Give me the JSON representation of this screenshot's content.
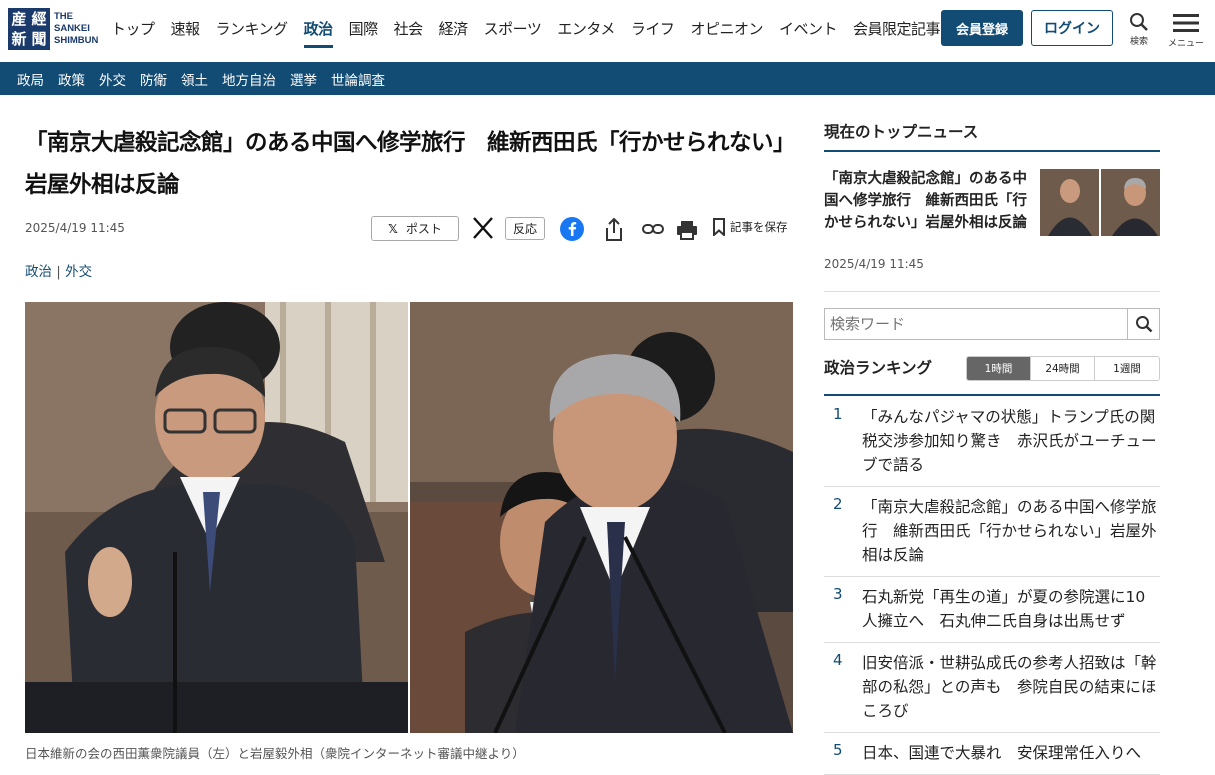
{
  "brand": {
    "logo_chars": [
      "産",
      "經",
      "新",
      "聞"
    ],
    "name_line1": "THE",
    "name_line2": "SANKEI",
    "name_line3": "SHIMBUN",
    "accent": "#124b73"
  },
  "nav": {
    "items": [
      "トップ",
      "速報",
      "ランキング",
      "政治",
      "国際",
      "社会",
      "経済",
      "スポーツ",
      "エンタメ",
      "ライフ",
      "オピニオン",
      "イベント",
      "会員限定記事"
    ],
    "active": "政治",
    "register_label": "会員登録",
    "login_label": "ログイン",
    "search_label": "検索",
    "menu_label": "メニュー"
  },
  "subnav": {
    "items": [
      "政局",
      "政策",
      "外交",
      "防衛",
      "領土",
      "地方自治",
      "選挙",
      "世論調査"
    ]
  },
  "article": {
    "headline": "「南京大虐殺記念館」のある中国へ修学旅行　維新西田氏「行かせられない」岩屋外相は反論",
    "date": "2025/4/19 11:45",
    "share_post": "ポスト",
    "share_react": "反応",
    "save_label": "記事を保存",
    "category_1": "政治",
    "category_sep": "|",
    "category_2": "外交",
    "caption": "日本維新の会の西田薫衆院議員（左）と岩屋毅外相（衆院インターネット審議中継より）"
  },
  "sidebar": {
    "top_news_heading": "現在のトップニュース",
    "top_news_title": "「南京大虐殺記念館」のある中国へ修学旅行　維新西田氏「行かせられない」岩屋外相は反論",
    "top_news_date": "2025/4/19 11:45",
    "search_placeholder": "検索ワード",
    "ranking_heading": "政治ランキング",
    "ranking_tabs": [
      "1時間",
      "24時間",
      "1週間"
    ],
    "ranking_active_tab": "1時間",
    "ranking": [
      {
        "num": "1",
        "title": "「みんなパジャマの状態」トランプ氏の関税交渉参加知り驚き　赤沢氏がユーチューブで語る"
      },
      {
        "num": "2",
        "title": "「南京大虐殺記念館」のある中国へ修学旅行　維新西田氏「行かせられない」岩屋外相は反論"
      },
      {
        "num": "3",
        "title": "石丸新党「再生の道」が夏の参院選に10人擁立へ　石丸伸二氏自身は出馬せず"
      },
      {
        "num": "4",
        "title": "旧安倍派・世耕弘成氏の参考人招致は「幹部の私怨」との声も　参院自民の結束にほころび"
      },
      {
        "num": "5",
        "title": "日本、国連で大暴れ　安保理常任入りへ"
      }
    ]
  }
}
